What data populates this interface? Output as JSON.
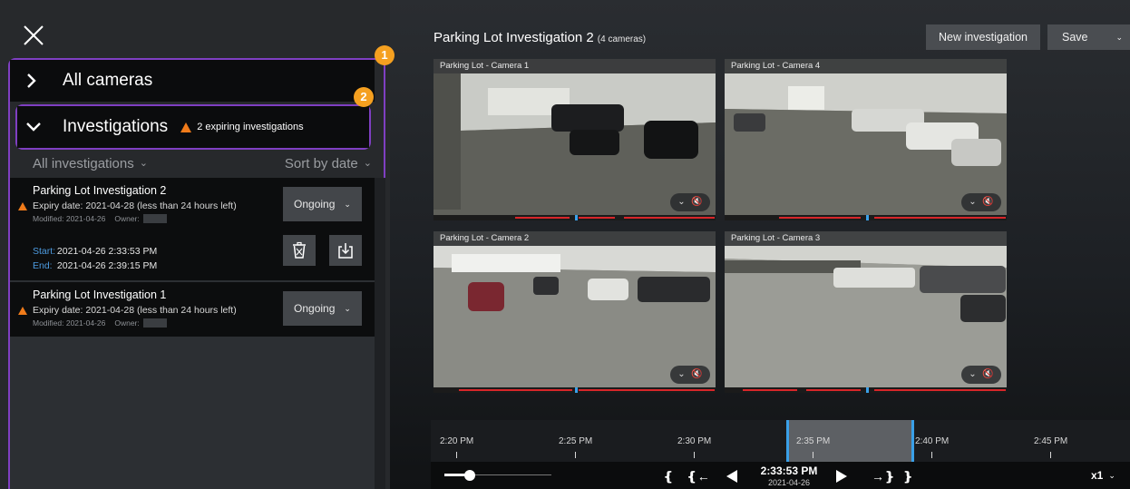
{
  "left_panel": {
    "close_icon": "close-icon",
    "badges": [
      "1",
      "2"
    ],
    "all_cameras_label": "All cameras",
    "investigations_label": "Investigations",
    "expiring_text": "2 expiring investigations",
    "filter_label": "All investigations",
    "sort_label": "Sort by date",
    "investigations": [
      {
        "title": "Parking Lot Investigation 2",
        "expiry": "Expiry date: 2021-04-28 (less than 24 hours left)",
        "modified": "Modified: 2021-04-26",
        "owner_label": "Owner:",
        "status": "Ongoing",
        "start_label": "Start:",
        "start_value": "2021-04-26 2:33:53 PM",
        "end_label": "End:",
        "end_value": "2021-04-26 2:39:15 PM"
      },
      {
        "title": "Parking Lot Investigation 1",
        "expiry": "Expiry date: 2021-04-28 (less than 24 hours left)",
        "modified": "Modified: 2021-04-26",
        "owner_label": "Owner:",
        "status": "Ongoing"
      }
    ]
  },
  "header": {
    "title": "Parking Lot Investigation 2",
    "camera_count": "(4 cameras)",
    "new_investigation_label": "New investigation",
    "save_label": "Save"
  },
  "cameras": [
    {
      "name": "Parking Lot - Camera 1"
    },
    {
      "name": "Parking Lot - Camera 4"
    },
    {
      "name": "Parking Lot - Camera 2"
    },
    {
      "name": "Parking Lot - Camera 3"
    }
  ],
  "timeline": {
    "ticks": [
      "2:20 PM",
      "2:25 PM",
      "2:30 PM",
      "2:35 PM",
      "2:40 PM",
      "2:45 PM"
    ]
  },
  "playback": {
    "current_time": "2:33:53 PM",
    "current_date": "2021-04-26",
    "speed": "x1"
  },
  "colors": {
    "accent_outline": "#7f3fc2",
    "badge": "#f5a020",
    "warning": "#f07b1a",
    "marker_blue": "#3aa0e8",
    "recording_red": "#d8262a"
  }
}
